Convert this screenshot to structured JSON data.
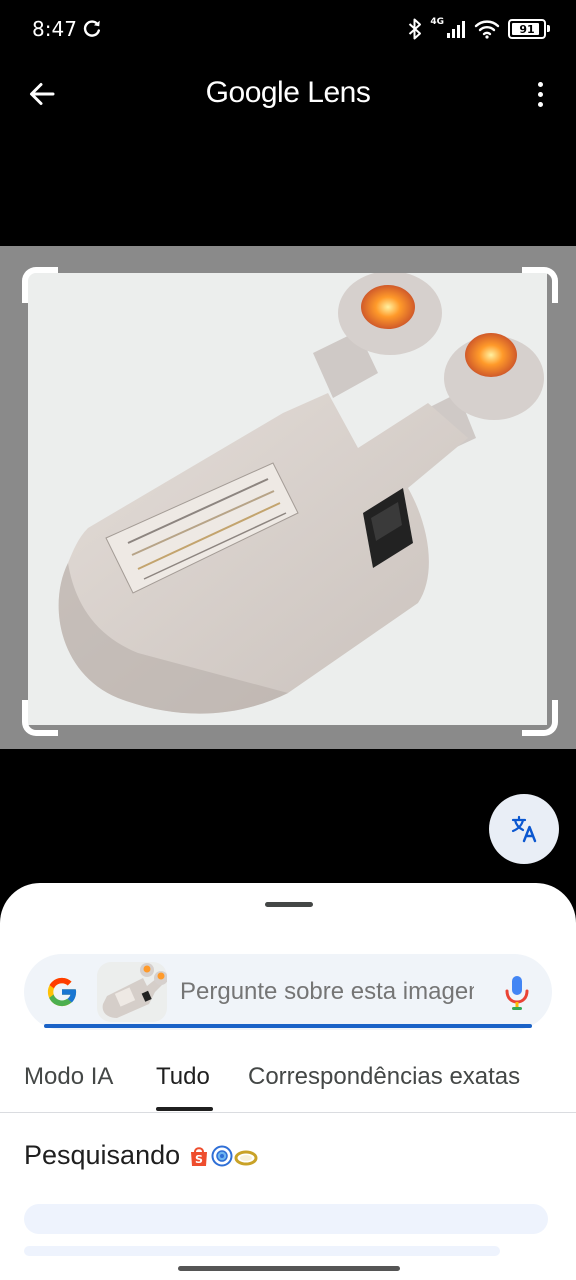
{
  "status_bar": {
    "time": "8:47",
    "network": "4G",
    "battery_level": "91",
    "battery_fraction": 0.91
  },
  "app_bar": {
    "title_brand": "Google",
    "title_product": "Lens",
    "icons": {
      "back": "arrow-back-icon",
      "menu": "more-vert-icon"
    }
  },
  "translate": {
    "icon": "translate-icon"
  },
  "search": {
    "placeholder": "Pergunte sobre esta imagem",
    "icons": {
      "logo": "google-g-icon",
      "mic": "mic-icon"
    }
  },
  "tabs": [
    {
      "label": "Modo IA"
    },
    {
      "label": "Tudo",
      "selected": true
    },
    {
      "label": "Correspondências exatas"
    }
  ],
  "results": {
    "status": "Pesquisando",
    "status_icons": [
      "shopping-bag-icon",
      "lens-icon",
      "ring-icon"
    ]
  },
  "colors": {
    "accent": "#1a62c7",
    "sheet_bg": "#ffffff",
    "search_bg": "#f0f4f9",
    "image_bg": "#8a8a8a"
  }
}
